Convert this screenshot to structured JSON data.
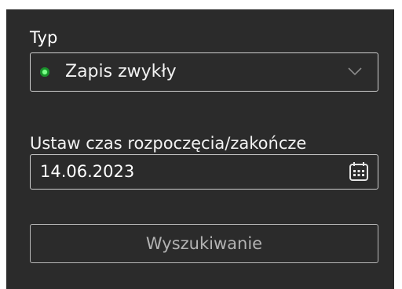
{
  "type_filter": {
    "label": "Typ",
    "selected_value": "Zapis zwykły",
    "status_color": "#27c93f",
    "status_icon": "green-dot-icon",
    "dropdown_icon": "chevron-down-icon"
  },
  "time_filter": {
    "label": "Ustaw czas rozpoczęcia/zakończe",
    "date_value": "14.06.2023",
    "calendar_icon": "calendar-icon"
  },
  "actions": {
    "search_label": "Wyszukiwanie"
  }
}
